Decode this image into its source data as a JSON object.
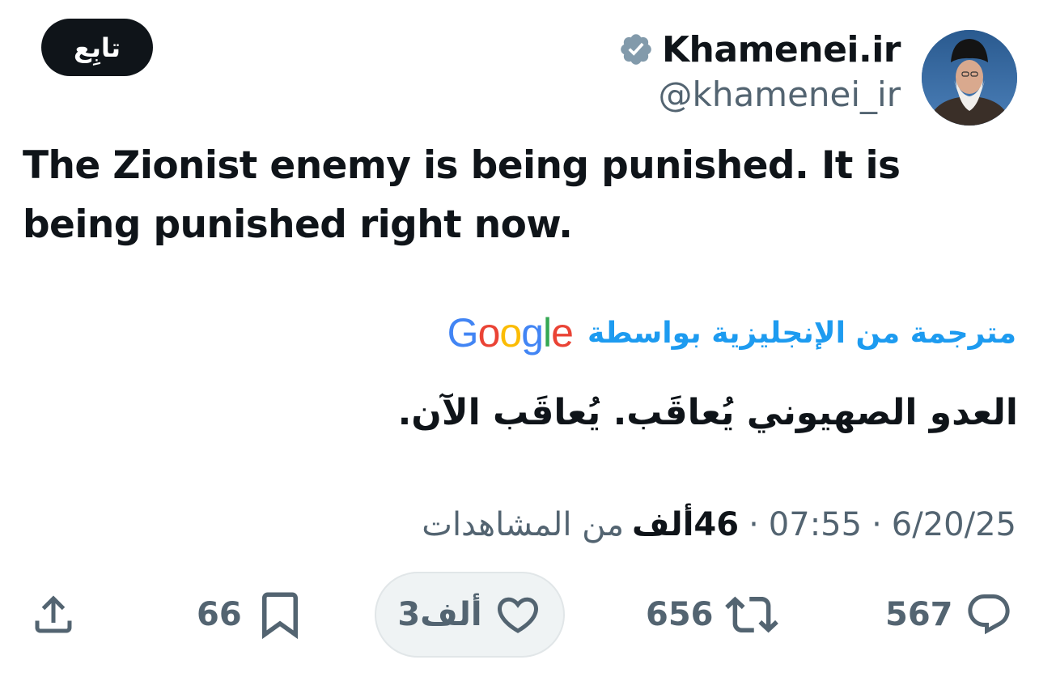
{
  "header": {
    "follow_label": "تابِع",
    "display_name": "Khamenei.ir",
    "handle": "@khamenei_ir"
  },
  "tweet": {
    "text": "The Zionist enemy is being punished. It is being punished right now."
  },
  "translation": {
    "label": "مترجمة من الإنجليزية بواسطة",
    "provider_logo_text": "Google",
    "text": "العدو الصهيوني يُعاقَب. يُعاقَب الآن."
  },
  "meta": {
    "date": "6/20/25",
    "separator": "·",
    "time": "07:55",
    "views_count": "46ألف",
    "views_label": "من المشاهدات"
  },
  "actions": {
    "replies": "567",
    "retweets": "656",
    "likes": "3ألف",
    "bookmarks": "66"
  },
  "colors": {
    "text_primary": "#0f1419",
    "text_secondary": "#536471",
    "accent_blue": "#1d9bf0",
    "verified_badge": "#829aab",
    "like_pill_bg": "#eff3f4"
  },
  "icons": [
    "verified-badge-icon",
    "reply-icon",
    "retweet-icon",
    "heart-icon",
    "bookmark-icon",
    "share-icon"
  ]
}
